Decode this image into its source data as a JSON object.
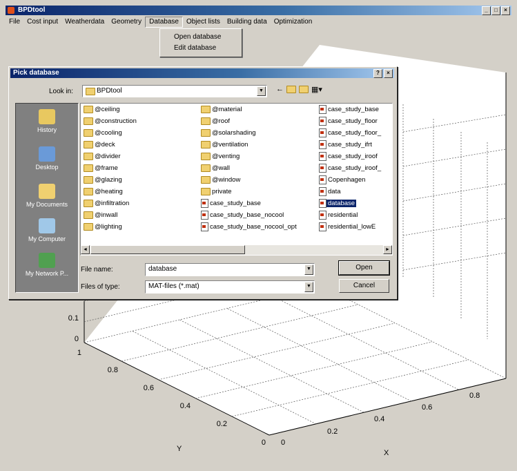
{
  "app": {
    "title": "BPDtool",
    "window_buttons": [
      "_",
      "□",
      "×"
    ]
  },
  "menubar": {
    "items": [
      "File",
      "Cost input",
      "Weatherdata",
      "Geometry",
      "Database",
      "Object lists",
      "Building data",
      "Optimization"
    ],
    "active": "Database"
  },
  "database_menu": {
    "items": [
      "Open database",
      "Edit database"
    ]
  },
  "plot": {
    "z_ticks": [
      "0",
      "0.1"
    ],
    "y_ticks": [
      "1",
      "0.8",
      "0.6",
      "0.4",
      "0.2",
      "0"
    ],
    "x_ticks": [
      "0",
      "0.2",
      "0.4",
      "0.6",
      "0.8"
    ],
    "ylabel": "Y",
    "xlabel": "X"
  },
  "dialog": {
    "title": "Pick database",
    "title_buttons": [
      "?",
      "×"
    ],
    "look_in_label": "Look in:",
    "look_in_value": "BPDtool",
    "places": [
      {
        "label": "History",
        "icon": "history-icon",
        "color": "#e8c860"
      },
      {
        "label": "Desktop",
        "icon": "desktop-icon",
        "color": "#6a9ad8"
      },
      {
        "label": "My Documents",
        "icon": "my-documents-icon",
        "color": "#f0d070"
      },
      {
        "label": "My Computer",
        "icon": "my-computer-icon",
        "color": "#a0c8e8"
      },
      {
        "label": "My Network P...",
        "icon": "my-network-icon",
        "color": "#50a050"
      }
    ],
    "columns": [
      [
        {
          "name": "@ceiling",
          "kind": "folder"
        },
        {
          "name": "@construction",
          "kind": "folder"
        },
        {
          "name": "@cooling",
          "kind": "folder"
        },
        {
          "name": "@deck",
          "kind": "folder"
        },
        {
          "name": "@divider",
          "kind": "folder"
        },
        {
          "name": "@frame",
          "kind": "folder"
        },
        {
          "name": "@glazing",
          "kind": "folder"
        },
        {
          "name": "@heating",
          "kind": "folder"
        },
        {
          "name": "@infiltration",
          "kind": "folder"
        },
        {
          "name": "@inwall",
          "kind": "folder"
        },
        {
          "name": "@lighting",
          "kind": "folder"
        }
      ],
      [
        {
          "name": "@material",
          "kind": "folder"
        },
        {
          "name": "@roof",
          "kind": "folder"
        },
        {
          "name": "@solarshading",
          "kind": "folder"
        },
        {
          "name": "@ventilation",
          "kind": "folder"
        },
        {
          "name": "@venting",
          "kind": "folder"
        },
        {
          "name": "@wall",
          "kind": "folder"
        },
        {
          "name": "@window",
          "kind": "folder"
        },
        {
          "name": "private",
          "kind": "folder"
        },
        {
          "name": "case_study_base",
          "kind": "file"
        },
        {
          "name": "case_study_base_nocool",
          "kind": "file"
        },
        {
          "name": "case_study_base_nocool_opt",
          "kind": "file"
        }
      ],
      [
        {
          "name": "case_study_base",
          "kind": "file"
        },
        {
          "name": "case_study_floor",
          "kind": "file"
        },
        {
          "name": "case_study_floor_",
          "kind": "file"
        },
        {
          "name": "case_study_ifrt",
          "kind": "file"
        },
        {
          "name": "case_study_iroof",
          "kind": "file"
        },
        {
          "name": "case_study_iroof_",
          "kind": "file"
        },
        {
          "name": "Copenhagen",
          "kind": "file"
        },
        {
          "name": "data",
          "kind": "file"
        },
        {
          "name": "database",
          "kind": "file",
          "selected": true
        },
        {
          "name": "residential",
          "kind": "file"
        },
        {
          "name": "residential_lowE",
          "kind": "file"
        }
      ]
    ],
    "file_name_label": "File name:",
    "file_name_value": "database",
    "file_type_label": "Files of type:",
    "file_type_value": "MAT-files (*.mat)",
    "open_label": "Open",
    "cancel_label": "Cancel"
  }
}
